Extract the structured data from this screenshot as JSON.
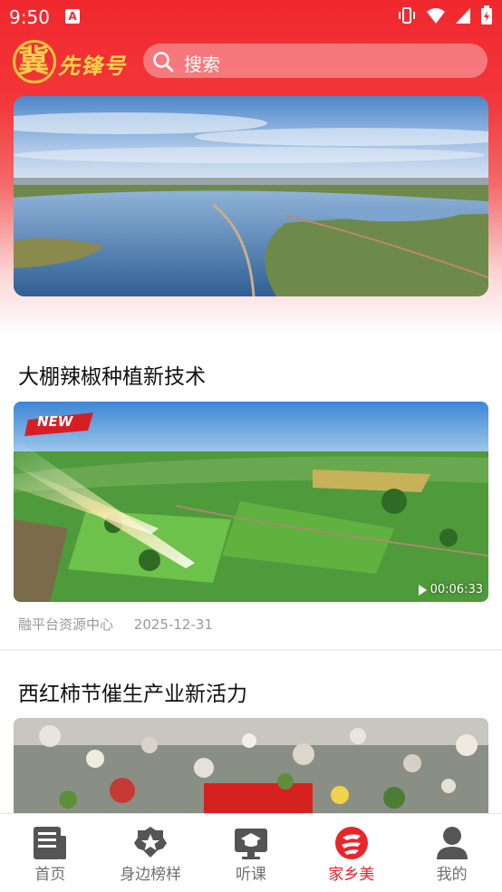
{
  "status_bar": {
    "time": "9:50",
    "notification_icon": "A",
    "icons": [
      "vibrate-icon",
      "wifi-icon",
      "signal-icon",
      "battery-icon"
    ]
  },
  "header": {
    "logo_main_char": "冀",
    "logo_text": "先锋号",
    "search_placeholder": "搜索",
    "search_icon": "search-icon"
  },
  "colors": {
    "brand_red": "#f0282e",
    "logo_gold": "#ffd24a",
    "active_nav": "#e8252b",
    "inactive_nav": "#707070",
    "meta_gray": "#9a9a9a"
  },
  "articles": [
    {
      "title": "大棚辣椒种植新技术",
      "badge": "NEW",
      "duration": "00:06:33",
      "source": "融平台资源中心",
      "date": "2025-12-31"
    },
    {
      "title": "西红柿节催生产业新活力"
    }
  ],
  "bottom_nav": [
    {
      "label": "首页",
      "icon": "news-icon",
      "active": false
    },
    {
      "label": "身边榜样",
      "icon": "star-badge-icon",
      "active": false
    },
    {
      "label": "听课",
      "icon": "graduation-monitor-icon",
      "active": false
    },
    {
      "label": "家乡美",
      "icon": "hometown-logo-icon",
      "active": true
    },
    {
      "label": "我的",
      "icon": "person-icon",
      "active": false
    }
  ]
}
